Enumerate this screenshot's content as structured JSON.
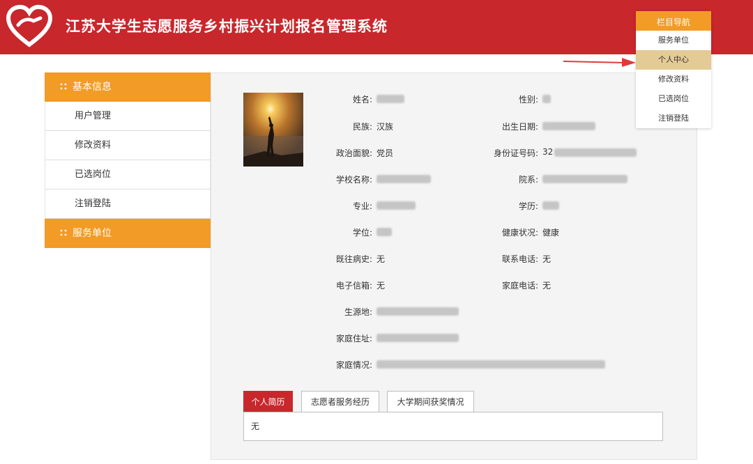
{
  "header": {
    "title": "江苏大学生志愿服务乡村振兴计划报名管理系统",
    "bg_color": "#c8272c",
    "logo_icon": "heart-hand-logo"
  },
  "top_nav": {
    "title": "栏目导航",
    "items": [
      {
        "label": "服务单位",
        "active": false
      },
      {
        "label": "个人中心",
        "active": true
      },
      {
        "label": "修改资料",
        "active": false
      },
      {
        "label": "已选岗位",
        "active": false
      },
      {
        "label": "注销登陆",
        "active": false
      }
    ]
  },
  "sidebar": {
    "section1": "基本信息",
    "items": [
      {
        "label": "用户管理"
      },
      {
        "label": "修改资料"
      },
      {
        "label": "已选岗位"
      },
      {
        "label": "注销登陆"
      }
    ],
    "section2": "服务单位",
    "accent": "#f29b26"
  },
  "profile": {
    "name_label": "姓名:",
    "gender_label": "性别:",
    "ethnicity_label": "民族:",
    "ethnicity": "汉族",
    "birthdate_label": "出生日期:",
    "political_label": "政治面貌:",
    "political": "党员",
    "id_label": "身份证号码:",
    "id_prefix": "32",
    "school_label": "学校名称:",
    "department_label": "院系:",
    "major_label": "专业:",
    "education_label": "学历:",
    "degree_label": "学位:",
    "health_label": "健康状况:",
    "health": "健康",
    "medical_history_label": "既往病史:",
    "medical_history": "无",
    "phone_label": "联系电话:",
    "phone": "无",
    "email_label": "电子信箱:",
    "email": "无",
    "home_phone_label": "家庭电话:",
    "home_phone": "无",
    "origin_label": "生源地:",
    "address_label": "家庭住址:",
    "family_label": "家庭情况:"
  },
  "tabs": {
    "items": [
      {
        "label": "个人简历",
        "active": true
      },
      {
        "label": "志愿者服务经历",
        "active": false
      },
      {
        "label": "大学期间获奖情况",
        "active": false
      }
    ],
    "content": "无"
  }
}
